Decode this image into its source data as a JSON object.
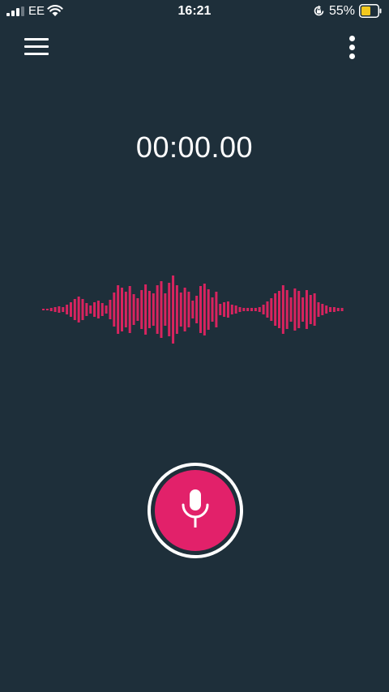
{
  "status_bar": {
    "carrier": "EE",
    "time": "16:21",
    "battery_percent": "55%",
    "battery_level": 0.55,
    "signal_bars_active": 3,
    "icons": [
      "signal-icon",
      "wifi-icon",
      "orientation-lock-icon",
      "battery-icon"
    ]
  },
  "toolbar": {
    "menu_icon": "hamburger-menu-icon",
    "more_icon": "more-vertical-icon"
  },
  "recorder": {
    "elapsed_time": "00:00.00",
    "record_icon": "microphone-icon"
  },
  "colors": {
    "background": "#1e2f3a",
    "accent": "#e2216a",
    "waveform": "#d8245f",
    "text": "#ffffff"
  }
}
